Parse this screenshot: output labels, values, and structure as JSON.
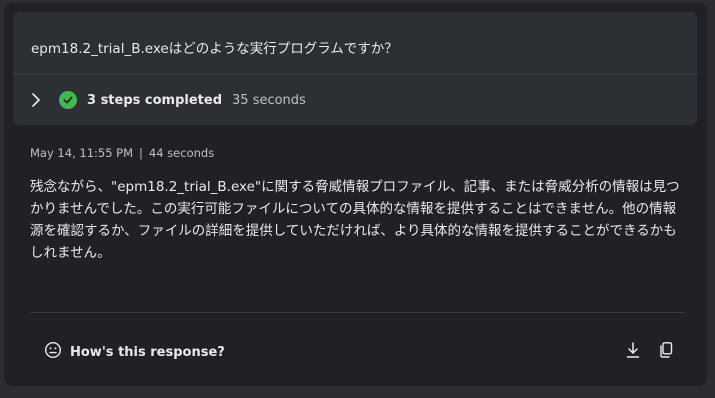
{
  "prompt": {
    "question": "epm18.2_trial_B.exeはどのような実行プログラムですか？"
  },
  "steps": {
    "label": "3 steps completed",
    "duration": "35 seconds"
  },
  "response": {
    "timestamp": "May 14, 11:55 PM",
    "separator": "|",
    "elapsed": "44 seconds",
    "text": "残念ながら、\"epm18.2_trial_B.exe\"に関する脅威情報プロファイル、記事、または脅威分析の情報は見つかりませんでした。この実行可能ファイルについての具体的な情報を提供することはできません。他の情報源を確認するか、ファイルの詳細を提供していただければ、より具体的な情報を提供することができるかもしれません。"
  },
  "footer": {
    "feedback_label": "How's this response?"
  },
  "icons": {
    "expand": "chevron-right-icon",
    "status": "check-circle-icon",
    "feedback": "smiley-icon",
    "download": "download-icon",
    "copy": "copy-icon"
  },
  "colors": {
    "page_bg": "#2b2d31",
    "panel_bg": "#202124",
    "card_bg": "#2c2f33",
    "success": "#3fb950"
  }
}
